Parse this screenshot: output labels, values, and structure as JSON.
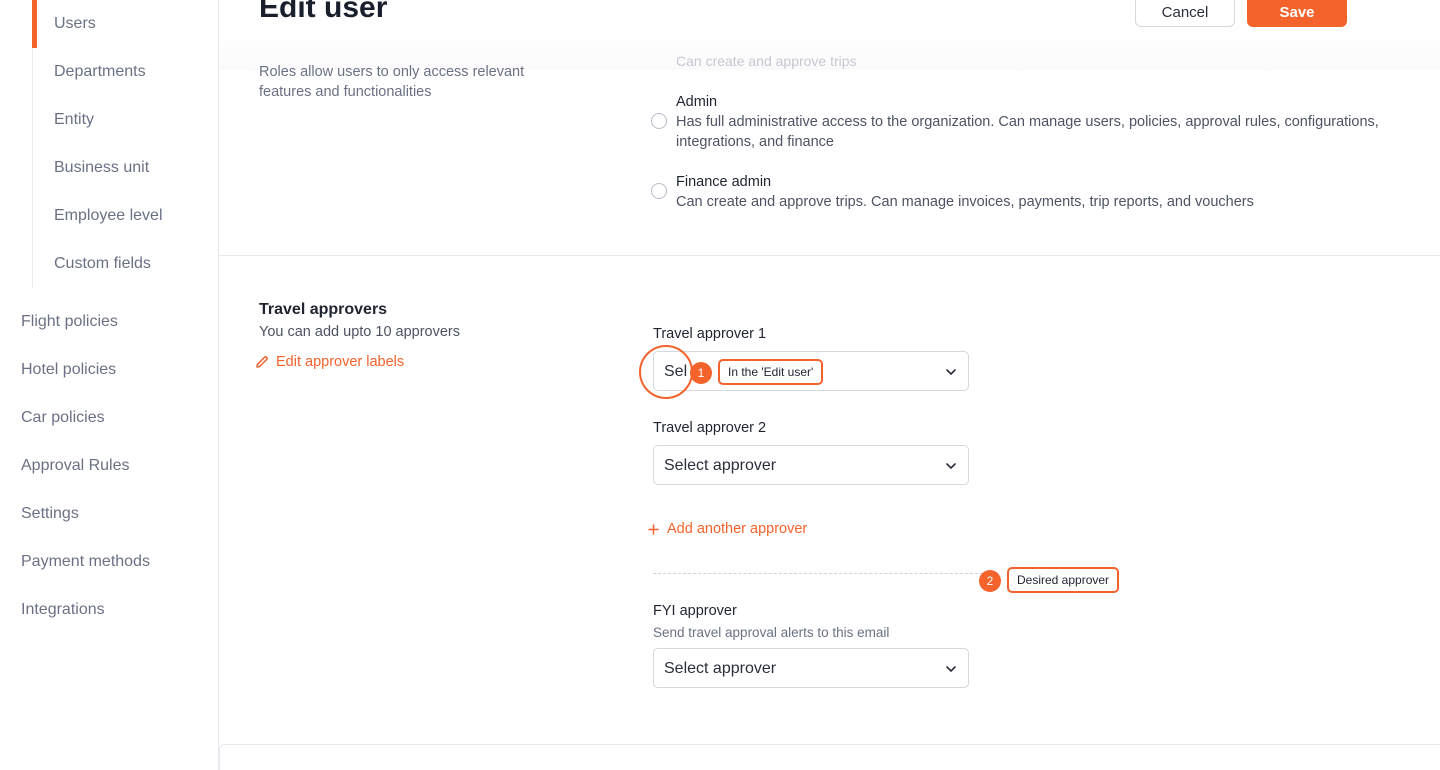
{
  "sidebar": {
    "sub_items": [
      "Users",
      "Departments",
      "Entity",
      "Business unit",
      "Employee level",
      "Custom fields"
    ],
    "active_sub_item": "Users",
    "items": [
      "Flight policies",
      "Hotel policies",
      "Car policies",
      "Approval Rules",
      "Settings",
      "Payment methods",
      "Integrations"
    ]
  },
  "header": {
    "title": "Edit user",
    "cancel_label": "Cancel",
    "save_label": "Save"
  },
  "roles": {
    "description": "Roles allow users to only access relevant features and functionalities",
    "faded_option_desc": "Can create and approve trips",
    "options": [
      {
        "title": "Admin",
        "description": "Has full administrative access to the organization. Can manage users, policies, approval rules, configurations, integrations, and finance",
        "selected": false
      },
      {
        "title": "Finance admin",
        "description": "Can create and approve trips. Can manage invoices, payments, trip reports, and vouchers",
        "selected": false
      }
    ]
  },
  "travel_approvers": {
    "title": "Travel approvers",
    "subtitle": "You can add upto 10 approvers",
    "edit_labels_link": "Edit approver labels",
    "approver_1_label": "Travel approver 1",
    "approver_1_value": "Sel",
    "approver_2_label": "Travel approver 2",
    "approver_2_value": "Select approver",
    "add_another": "Add another approver",
    "fyi_label": "FYI approver",
    "fyi_sub": "Send travel approval alerts to this email",
    "fyi_value": "Select approver"
  },
  "annotations": [
    {
      "number": "1",
      "label": "In the 'Edit user'"
    },
    {
      "number": "2",
      "label": "Desired approver"
    }
  ],
  "colors": {
    "accent": "#f4632c",
    "text_muted": "#6b7185",
    "border": "#d5d8df"
  }
}
